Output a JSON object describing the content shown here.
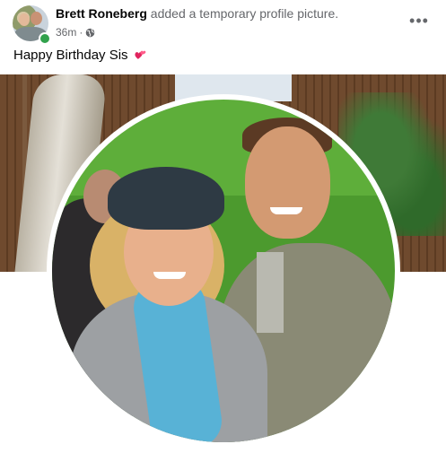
{
  "post": {
    "author": "Brett Roneberg",
    "action": " added a temporary profile picture.",
    "time": "36m",
    "separator": "·",
    "audience_icon": "globe-icon",
    "more_icon": "more-options-icon",
    "more_label": "•••",
    "text": "Happy Birthday Sis",
    "emoji_icon": "two-hearts-icon"
  },
  "colors": {
    "online": "#31a24c",
    "secondary_text": "#65676b",
    "primary_text": "#050505"
  }
}
